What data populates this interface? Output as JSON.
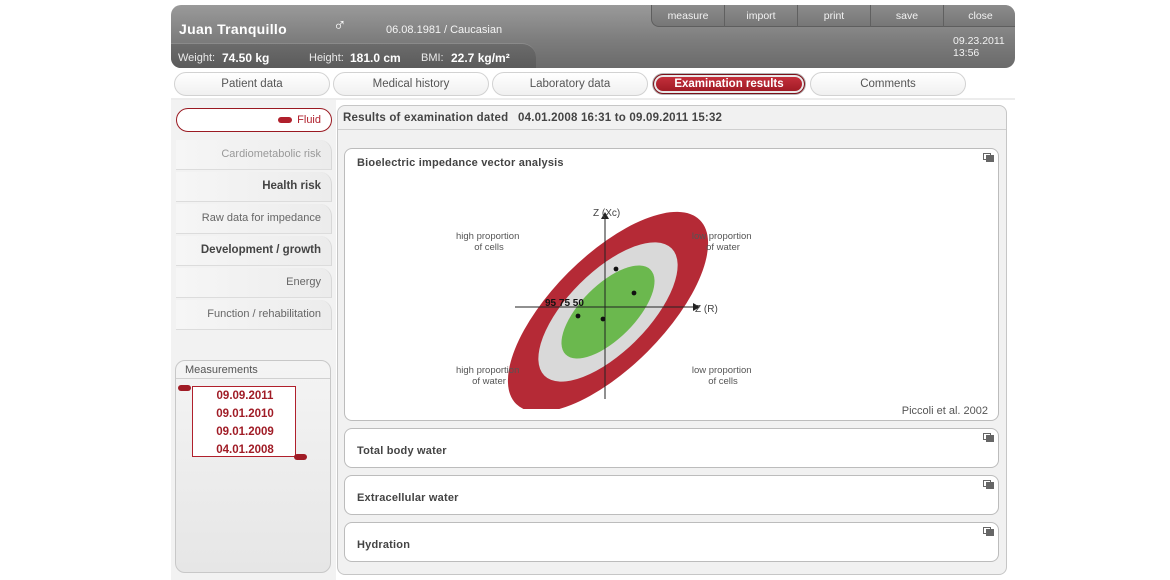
{
  "header": {
    "patient_name": "Juan Tranquillo",
    "sex_symbol": "♂",
    "dob": "06.08.1981",
    "ethnicity": "/  Caucasian",
    "weight_label": "Weight:",
    "weight_value": "74.50 kg",
    "height_label": "Height:",
    "height_value": "181.0 cm",
    "bmi_label": "BMI:",
    "bmi_value": "22.7 kg/m²",
    "date": "09.23.2011",
    "time": "13:56",
    "toolbar": [
      "measure",
      "import",
      "print",
      "save",
      "close"
    ]
  },
  "tabs": [
    {
      "label": "Patient data",
      "active": false
    },
    {
      "label": "Medical history",
      "active": false
    },
    {
      "label": "Laboratory data",
      "active": false
    },
    {
      "label": "Examination results",
      "active": true
    },
    {
      "label": "Comments",
      "active": false
    }
  ],
  "sidebar": {
    "items": [
      {
        "label": "Fluid",
        "state": "active"
      },
      {
        "label": "Cardiometabolic risk",
        "state": "light"
      },
      {
        "label": "Health risk",
        "state": "bold"
      },
      {
        "label": "Raw data for impedance",
        "state": "normal"
      },
      {
        "label": "Development / growth",
        "state": "bold"
      },
      {
        "label": "Energy",
        "state": "normal"
      },
      {
        "label": "Function / rehabilitation",
        "state": "normal"
      }
    ],
    "measurements_title": "Measurements",
    "measurements": [
      "09.09.2011",
      "09.01.2010",
      "09.01.2009",
      "04.01.2008"
    ]
  },
  "results": {
    "title": "Results of examination dated",
    "dates": "04.01.2008 16:31 to 09.09.2011 15:32",
    "bivia": {
      "title": "Bioelectric impedance vector analysis",
      "y_axis": "Z (Xc)",
      "x_axis": "Z (R)",
      "q_top_left": [
        "high proportion",
        "of cells"
      ],
      "q_top_right": [
        "low proportion",
        "of water"
      ],
      "q_bottom_left": [
        "high proportion",
        "of water"
      ],
      "q_bottom_right": [
        "low proportion",
        "of cells"
      ],
      "percentiles_label": "95 75 50",
      "citation": "Piccoli et al. 2002",
      "colors": {
        "outer": "#b52a36",
        "middle": "#d8d8d8",
        "inner": "#6bb84e"
      }
    },
    "panels": [
      "Total body water",
      "Extracellular water",
      "Hydration"
    ]
  }
}
